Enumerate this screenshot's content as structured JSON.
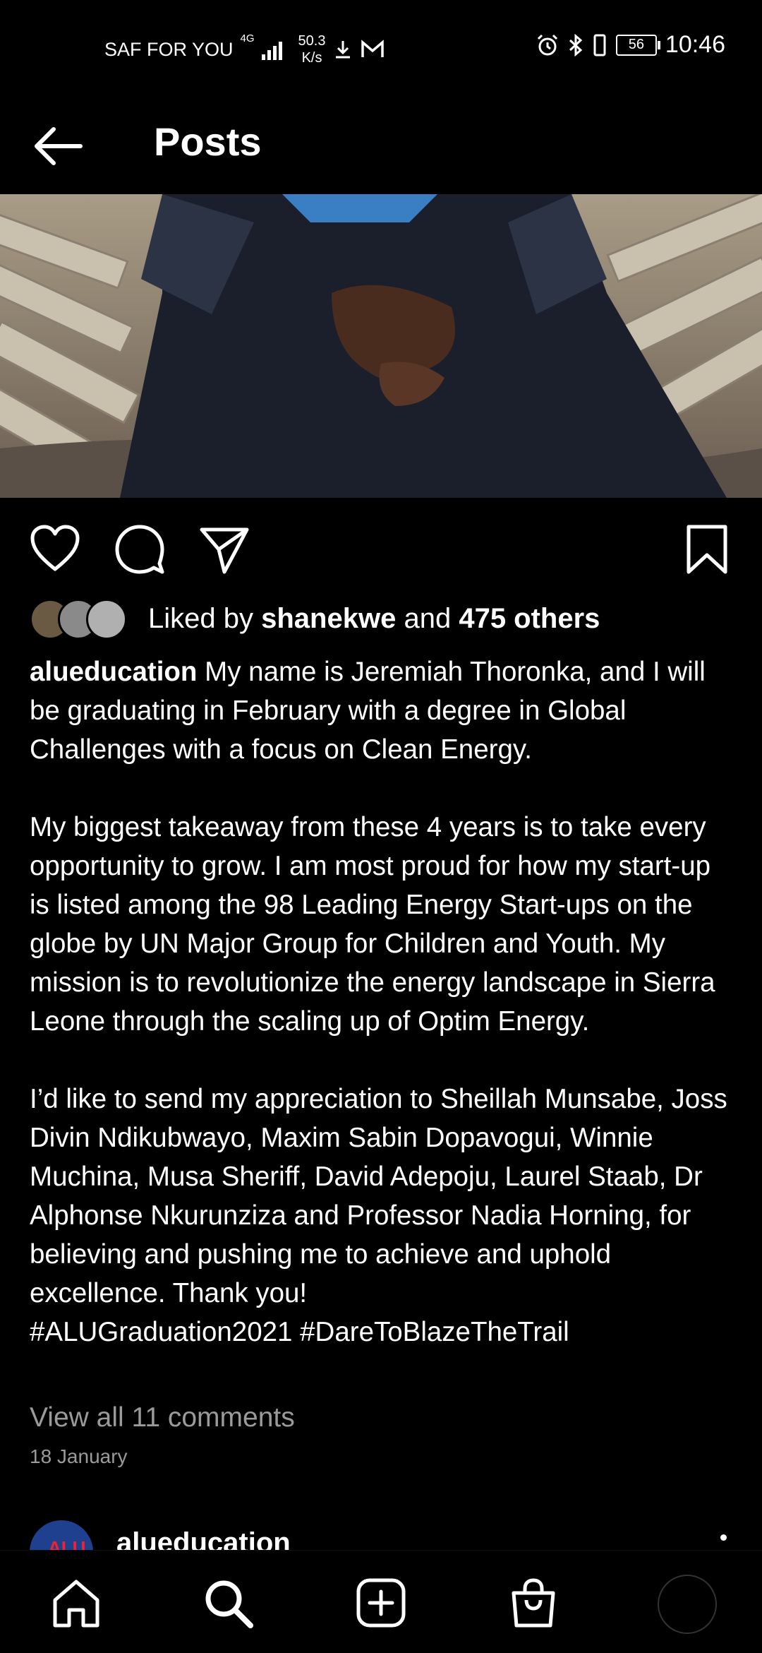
{
  "status_bar": {
    "carrier": "SAF FOR YOU",
    "network": "4G",
    "speed_value": "50.3",
    "speed_unit": "K/s",
    "battery": "56",
    "time": "10:46"
  },
  "header": {
    "title": "Posts"
  },
  "post": {
    "liked_by_prefix": "Liked by",
    "liked_by_user": "shanekwe",
    "liked_by_middle": "and",
    "liked_by_others": "475 others",
    "author": "alueducation",
    "caption": " My name is Jeremiah Thoronka, and I will be graduating in February with a degree in Global Challenges with a focus on Clean Energy.\n\nMy biggest takeaway from these 4 years is to take every opportunity to grow. I am most proud for how my start-up is listed among the 98 Leading Energy Start-ups on the globe by UN Major Group for Children and Youth. My mission is to revolutionize the energy landscape in Sierra Leone through the scaling up of Optim Energy.\n\nI’d like to send my appreciation to Sheillah Munsabe, Joss Divin Ndikubwayo, Maxim Sabin Dopavogui, Winnie Muchina, Musa Sheriff, David Adepoju, Laurel Staab, Dr Alphonse Nkurunziza and Professor Nadia Horning, for believing and pushing me to achieve and uphold excellence. Thank you!\n#ALUGraduation2021 #DareToBlazeTheTrail",
    "view_comments": "View all 11 comments",
    "date": "18 January"
  },
  "next_post": {
    "author": "alueducation"
  },
  "icons": {
    "back": "arrow-left-icon",
    "like": "heart-icon",
    "comment": "comment-bubble-icon",
    "share": "paper-plane-icon",
    "save": "bookmark-icon",
    "home": "home-icon",
    "search": "search-icon",
    "create": "plus-square-icon",
    "shop": "shopping-bag-icon"
  },
  "colors": {
    "background": "#000000",
    "text": "#ffffff",
    "muted": "#9a9a9a"
  }
}
